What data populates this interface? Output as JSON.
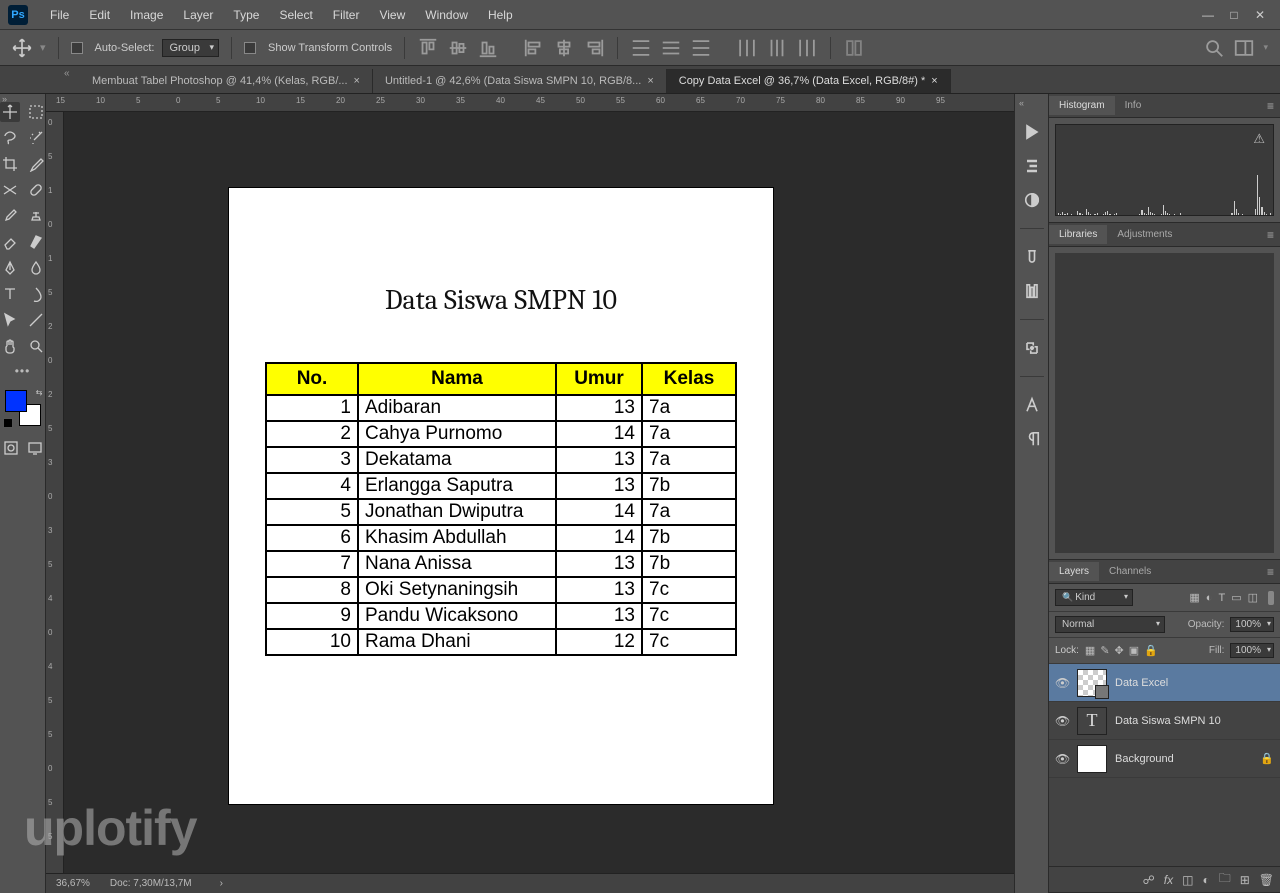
{
  "app": {
    "name": "Ps"
  },
  "menu": [
    "File",
    "Edit",
    "Image",
    "Layer",
    "Type",
    "Select",
    "Filter",
    "View",
    "Window",
    "Help"
  ],
  "options": {
    "auto_select_label": "Auto-Select:",
    "group_label": "Group",
    "show_transform_label": "Show Transform Controls"
  },
  "tabs": [
    {
      "label": "Membuat Tabel Photoshop @ 41,4% (Kelas, RGB/...",
      "active": false
    },
    {
      "label": "Untitled-1 @ 42,6% (Data Siswa SMPN 10, RGB/8...",
      "active": false
    },
    {
      "label": "Copy Data Excel @ 36,7% (Data Excel, RGB/8#) *",
      "active": true
    }
  ],
  "ruler_h": [
    "15",
    "10",
    "5",
    "0",
    "5",
    "10",
    "15",
    "20",
    "25",
    "30",
    "35",
    "40",
    "45",
    "50",
    "55",
    "60",
    "65",
    "70",
    "75",
    "80",
    "85",
    "90",
    "95"
  ],
  "ruler_v": [
    "0",
    "5",
    "1",
    "0",
    "1",
    "5",
    "2",
    "0",
    "2",
    "5",
    "3",
    "0",
    "3",
    "5",
    "4",
    "0",
    "4",
    "5",
    "5",
    "0",
    "5",
    "5"
  ],
  "document": {
    "title": "Data Siswa SMPN 10",
    "headers": {
      "no": "No.",
      "nama": "Nama",
      "umur": "Umur",
      "kelas": "Kelas"
    },
    "rows": [
      {
        "no": "1",
        "nama": "Adibaran",
        "umur": "13",
        "kelas": "7a"
      },
      {
        "no": "2",
        "nama": "Cahya Purnomo",
        "umur": "14",
        "kelas": "7a"
      },
      {
        "no": "3",
        "nama": "Dekatama",
        "umur": "13",
        "kelas": "7a"
      },
      {
        "no": "4",
        "nama": "Erlangga Saputra",
        "umur": "13",
        "kelas": "7b"
      },
      {
        "no": "5",
        "nama": "Jonathan Dwiputra",
        "umur": "14",
        "kelas": "7a"
      },
      {
        "no": "6",
        "nama": "Khasim Abdullah",
        "umur": "14",
        "kelas": "7b"
      },
      {
        "no": "7",
        "nama": "Nana Anissa",
        "umur": "13",
        "kelas": "7b"
      },
      {
        "no": "8",
        "nama": "Oki Setynaningsih",
        "umur": "13",
        "kelas": "7c"
      },
      {
        "no": "9",
        "nama": "Pandu Wicaksono",
        "umur": "13",
        "kelas": "7c"
      },
      {
        "no": "10",
        "nama": "Rama Dhani",
        "umur": "12",
        "kelas": "7c"
      }
    ]
  },
  "status": {
    "zoom": "36,67%",
    "docsize": "Doc: 7,30M/13,7M"
  },
  "panels": {
    "histogram_tab": "Histogram",
    "info_tab": "Info",
    "libraries_tab": "Libraries",
    "adjustments_tab": "Adjustments",
    "layers_tab": "Layers",
    "channels_tab": "Channels"
  },
  "layers": {
    "filter_kind": "Kind",
    "blend_mode": "Normal",
    "opacity_label": "Opacity:",
    "opacity_value": "100%",
    "lock_label": "Lock:",
    "fill_label": "Fill:",
    "fill_value": "100%",
    "items": [
      {
        "name": "Data Excel",
        "type": "smart",
        "selected": true
      },
      {
        "name": "Data Siswa SMPN 10",
        "type": "text",
        "selected": false
      },
      {
        "name": "Background",
        "type": "raster",
        "selected": false,
        "locked": true
      }
    ]
  },
  "colors": {
    "foreground": "#0033ff"
  },
  "watermark": "uplotify"
}
